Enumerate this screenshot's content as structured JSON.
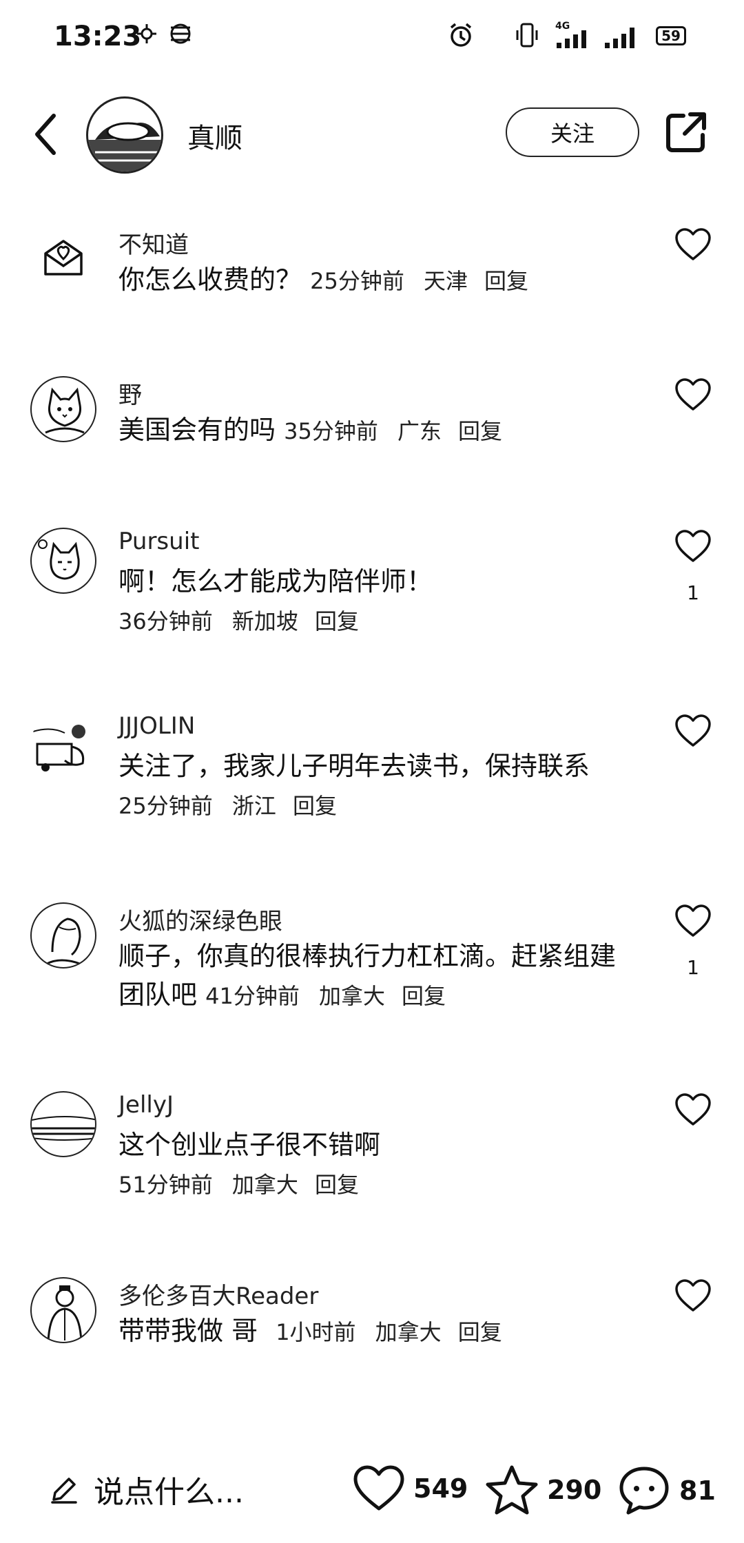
{
  "status_bar": {
    "time": "13:23",
    "battery": "59",
    "network": "4G"
  },
  "header": {
    "author_name": "真顺",
    "follow_label": "关注"
  },
  "comments": [
    {
      "name": "不知道",
      "text": "你怎么收费的？",
      "time": "25分钟前",
      "location": "天津",
      "reply": "回复",
      "likes": ""
    },
    {
      "name": "野",
      "text": "美国会有的吗",
      "time": "35分钟前",
      "location": "广东",
      "reply": "回复",
      "likes": ""
    },
    {
      "name": "Pursuit",
      "text": "啊！怎么才能成为陪伴师！",
      "time": "36分钟前",
      "location": "新加坡",
      "reply": "回复",
      "likes": "1"
    },
    {
      "name": "JJJOLIN",
      "text": "关注了，我家儿子明年去读书，保持联系",
      "time": "25分钟前",
      "location": "浙江",
      "reply": "回复",
      "likes": ""
    },
    {
      "name": "火狐的深绿色眼",
      "text": "顺子，你真的很棒执行力杠杠滴。赶紧组建团队吧",
      "time": "41分钟前",
      "location": "加拿大",
      "reply": "回复",
      "likes": "1"
    },
    {
      "name": "JellyJ",
      "text": "这个创业点子很不错啊",
      "time": "51分钟前",
      "location": "加拿大",
      "reply": "回复",
      "likes": ""
    },
    {
      "name": "多伦多百大Reader",
      "text": "带带我做 哥",
      "time": "1小时前",
      "location": "加拿大",
      "reply": "回复",
      "likes": ""
    }
  ],
  "bottom_bar": {
    "compose_placeholder": "说点什么...",
    "likes_count": "549",
    "favorites_count": "290",
    "comments_count": "81"
  },
  "colors": {
    "text": "#111111",
    "background": "#ffffff"
  }
}
